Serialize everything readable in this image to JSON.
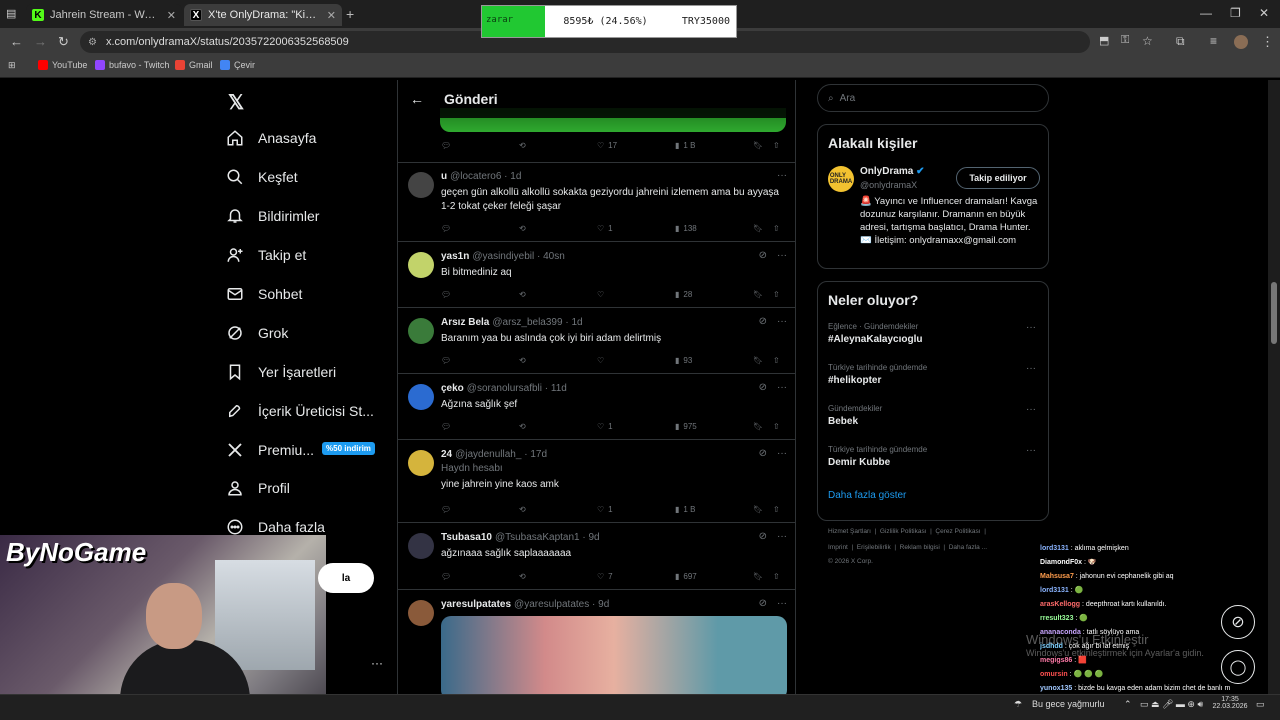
{
  "browser": {
    "tabs": [
      {
        "title": "Jahrein Stream - Watch Live on"
      },
      {
        "title": "X'te OnlyDrama: \"Kick'te yayınla"
      }
    ],
    "url": "x.com/onlydramaX/status/2035722006352568509",
    "bookmarks": [
      "YouTube",
      "bufavo - Twitch",
      "Gmail",
      "Çevir"
    ]
  },
  "ticker": {
    "label": "zarar",
    "value": "8595₺ (24.56%)",
    "total": "TRY35000"
  },
  "nav": {
    "items": [
      "Anasayfa",
      "Keşfet",
      "Bildirimler",
      "Takip et",
      "Sohbet",
      "Grok",
      "Yer İşaretleri",
      "İçerik Üreticisi St...",
      "Premiu...",
      "Profil",
      "Daha fazla"
    ],
    "promo": "%50 indirim"
  },
  "post": {
    "header_title": "Gönderi",
    "top_stats": [
      "17",
      "1 B"
    ]
  },
  "replies": [
    {
      "name": "u",
      "handle": "@locatero6",
      "time": "1d",
      "text": "geçen gün alkollü alkollü sokakta geziyordu jahreini izlemem ama bu ayyaşa 1-2 tokat çeker feleği şaşar",
      "likes": "1",
      "views": "138"
    },
    {
      "name": "yas1n",
      "handle": "@yasindiyebil",
      "time": "40sn",
      "text": "Bi bitmediniz aq",
      "likes": "",
      "views": "28"
    },
    {
      "name": "Arsız Bela",
      "handle": "@arsz_bela399",
      "time": "1d",
      "text": "Baranım yaa bu aslında çok iyi biri adam delirtmiş",
      "likes": "",
      "views": "93"
    },
    {
      "name": "çeko",
      "handle": "@soranolursafbli",
      "time": "11d",
      "text": "Ağzına sağlık şef",
      "likes": "1",
      "views": "975"
    },
    {
      "name": "24",
      "handle": "@jaydenullah_",
      "time": "17d",
      "subtitle": "Haydn hesabı",
      "text": "yine jahrein yine kaos amk",
      "likes": "1",
      "views": "1 B"
    },
    {
      "name": "Tsubasa10",
      "handle": "@TsubasaKaptan1",
      "time": "9d",
      "text": "ağzınaaa sağlık saplaaaaaaa",
      "likes": "7",
      "views": "697"
    },
    {
      "name": "yaresulpatates",
      "handle": "@yaresulpatates",
      "time": "9d",
      "text": "",
      "likes": "",
      "views": ""
    }
  ],
  "right": {
    "search_placeholder": "Ara",
    "relevant_title": "Alakalı kişiler",
    "profile": {
      "name": "OnlyDrama",
      "handle": "@onlydramaX",
      "follow": "Takip ediliyor",
      "bio": "🚨 Yayıncı ve Influencer dramaları! Kavga dozunuz karşılanır. Dramanın en büyük adresi, tartışma başlatıcı, Drama Hunter. ✉️ İletişim: onlydramaxx@gmail.com"
    },
    "trending_title": "Neler oluyor?",
    "trends": [
      {
        "category": "Eğlence · Gündemdekiler",
        "name": "#AleynaKalaycıoglu"
      },
      {
        "category": "Türkiye tarihinde gündemde",
        "name": "#helikopter"
      },
      {
        "category": "Gündemdekiler",
        "name": "Bebek"
      },
      {
        "category": "Türkiye tarihinde gündemde",
        "name": "Demir Kubbe"
      }
    ],
    "show_more": "Daha fazla göster",
    "footer": [
      "Hizmet Şartları",
      "Gizlilik Politikası",
      "Çerez Politikası",
      "Imprint",
      "Erişilebilirlik",
      "Reklam bilgisi",
      "Daha fazla ...",
      "© 2026 X Corp."
    ]
  },
  "overlay": {
    "brand": "ByNoGame",
    "button": "la"
  },
  "chat": [
    {
      "user": "lord3131",
      "msg": "aklıma gelmişken",
      "color": "#8ab4ff"
    },
    {
      "user": "DiamondF0x",
      "msg": "🐶",
      "color": "#ffffff"
    },
    {
      "user": "Mahsusa7",
      "msg": "jahonun evi cephanelik gibi aq",
      "color": "#ff9d4d"
    },
    {
      "user": "lord3131",
      "msg": "🟢",
      "color": "#8ab4ff"
    },
    {
      "user": "arasKellogg",
      "msg": "deepthroat kartı kullanıldı.",
      "color": "#ff6b6b"
    },
    {
      "user": "rresult323",
      "msg": "🟢",
      "color": "#9aff9a"
    },
    {
      "user": "ananaconda",
      "msg": "tatlı söylüyo ama",
      "color": "#c9a6ff"
    },
    {
      "user": "jsdhdd",
      "msg": "çok ağır bi laf etmiş",
      "color": "#7fd0ff"
    },
    {
      "user": "megigs86",
      "msg": "🟥",
      "color": "#ff7aa8"
    },
    {
      "user": "omursin",
      "msg": "🟢 🟢 🟢",
      "color": "#ff5050"
    },
    {
      "user": "yunox135",
      "msg": "bizde bu kavga eden adam bizim chet de banlı mı",
      "color": "#a0c8ff"
    },
    {
      "user": "@bufavo",
      "msg": "",
      "color": "#9a9a9a"
    }
  ],
  "windows_activate": {
    "title": "Windows'u Etkinleştir",
    "sub": "Windows'u etkinleştirmek için Ayarlar'a gidin."
  },
  "taskbar": {
    "weather": "Bu gece yağmurlu",
    "time": "17:35",
    "date": "22.03.2026"
  }
}
